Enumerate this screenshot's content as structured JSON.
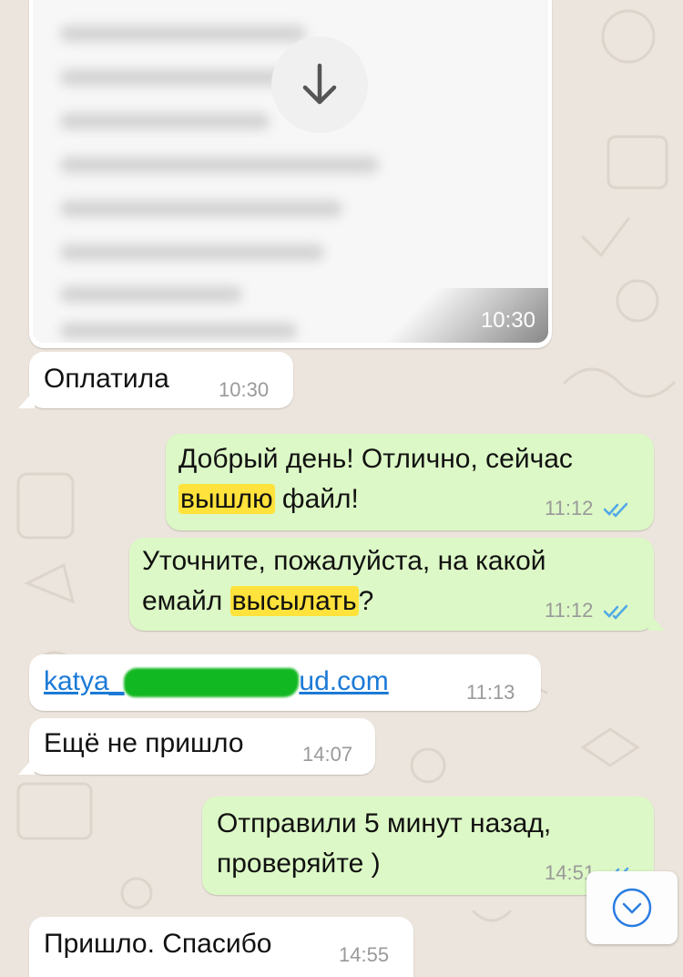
{
  "image_message": {
    "time": "10:30"
  },
  "messages": [
    {
      "text": "Оплатила",
      "time": "10:30"
    },
    {
      "parts": [
        "Добрый день! Отлично, сейчас",
        "вышлю",
        "файл!"
      ],
      "time": "11:12"
    },
    {
      "parts": [
        "Уточните, пожалуйста, на какой",
        "емайл",
        "высылать",
        "?"
      ],
      "time": "11:12"
    },
    {
      "link_start": "katya_",
      "link_end": "ud.com",
      "time": "11:13"
    },
    {
      "text": "Ещё не пришло",
      "time": "14:07"
    },
    {
      "lines": [
        "Отправили 5 минут назад,",
        "проверяйте )"
      ],
      "time": "14:51"
    },
    {
      "text": "Пришло. Спасибо",
      "time": "14:55"
    }
  ],
  "icons": {
    "download": "arrow-down-icon",
    "read_receipt": "double-check-icon",
    "scroll_down": "chevron-down-icon"
  },
  "colors": {
    "incoming_bubble": "#ffffff",
    "outgoing_bubble": "#dcf8c6",
    "highlight": "#ffe23b",
    "link": "#1c7ad6",
    "read_check": "#4fa8e8",
    "chat_background": "#ece5dd"
  }
}
